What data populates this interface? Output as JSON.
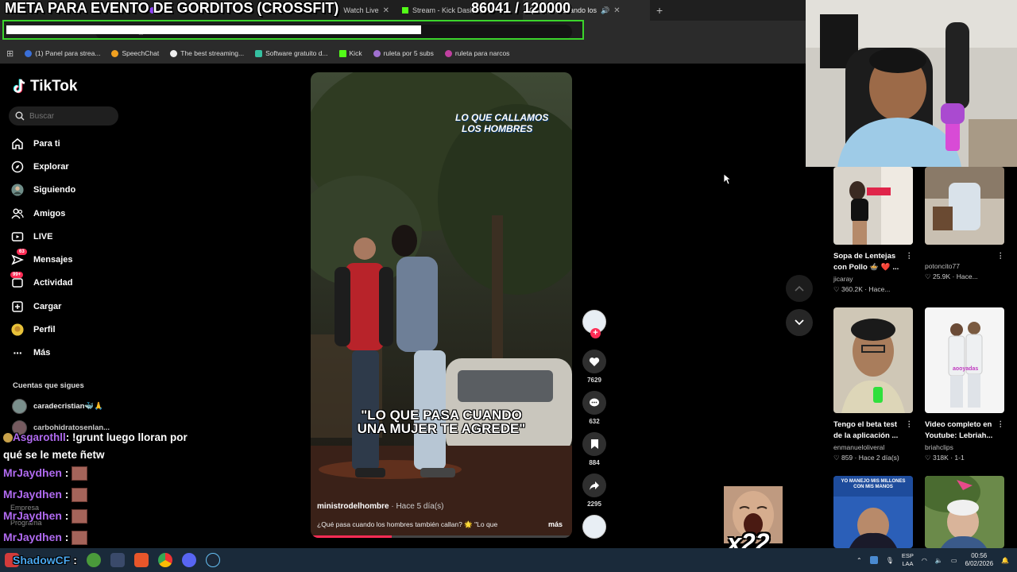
{
  "overlay": {
    "title": "META PARA EVENTO DE GORDITOS (CROSSFIT)",
    "counter": "86041   / 120000",
    "progress": 0.717
  },
  "browser": {
    "tabs": [
      {
        "label": "",
        "icon": "speaker-icon"
      },
      {
        "label": "",
        "icon": "twitch-icon"
      },
      {
        "label": "Watch Live",
        "icon": "kick-icon"
      },
      {
        "label": "Stream - Kick Dashboard",
        "icon": "kick-icon"
      },
      {
        "label": "Qué pasa cuando los",
        "icon": "tiktok-icon",
        "active": true
      }
    ],
    "url": "tiktok.com/@ministrodelhombre/video/7...",
    "bookmarks": [
      {
        "label": "(1) Panel para strea...",
        "color": "#3a6fd8"
      },
      {
        "label": "SpeechChat",
        "color": "#f0a020"
      },
      {
        "label": "The best streaming...",
        "color": "#eeeeee"
      },
      {
        "label": "Software gratuito d...",
        "color": "#35c0a0"
      },
      {
        "label": "Kick",
        "color": "#53fc18"
      },
      {
        "label": "ruleta por 5 subs",
        "color": "#a070d0"
      },
      {
        "label": "ruleta para narcos",
        "color": "#c040a0"
      }
    ]
  },
  "tiktok": {
    "logo": "TikTok",
    "search_placeholder": "Buscar",
    "nav": [
      {
        "label": "Para ti",
        "icon": "home-icon"
      },
      {
        "label": "Explorar",
        "icon": "compass-icon"
      },
      {
        "label": "Siguiendo",
        "icon": "avatar-icon"
      },
      {
        "label": "Amigos",
        "icon": "friends-icon"
      },
      {
        "label": "LIVE",
        "icon": "live-icon"
      },
      {
        "label": "Mensajes",
        "icon": "messages-icon",
        "badge": "63"
      },
      {
        "label": "Actividad",
        "icon": "activity-icon",
        "badge": "99+"
      },
      {
        "label": "Cargar",
        "icon": "upload-icon"
      },
      {
        "label": "Perfil",
        "icon": "profile-icon"
      },
      {
        "label": "Más",
        "icon": "more-icon"
      }
    ],
    "following_title": "Cuentas que sigues",
    "following": [
      {
        "name": "caradecristian🐳🙏"
      },
      {
        "name": "carbohidratosenlan..."
      }
    ],
    "ghost": [
      "Empresa",
      "Programa"
    ]
  },
  "video": {
    "logo_line1": "LO QUE CALLAMOS",
    "logo_line2": "LOS HOMBRES",
    "caption_line1": "\"LO QUE PASA CUANDO",
    "caption_line2": "UNA MUJER TE AGREDE\"",
    "author": "ministrodelhombre",
    "time": " · Hace 5 día(s)",
    "description": "¿Qué pasa cuando los hombres también callan? 🌟 \"Lo que",
    "more": "más",
    "progress": 0.31,
    "likes": "7629",
    "comments": "632",
    "saves": "884",
    "shares": "2295"
  },
  "grid": [
    {
      "title_line1": "Sopa de Lentejas",
      "title_line2": "con Pollo 🍲 ❤️ ...",
      "user": "jicaray",
      "meta": "♡ 360.2K · Hace..."
    },
    {
      "title_line1": "",
      "title_line2": "",
      "user": "potoncito77",
      "meta": "♡ 25.9K · Hace..."
    },
    {
      "title_line1": "Tengo el beta test",
      "title_line2": "de la aplicación ...",
      "user": "enmanueloliveral",
      "meta": "♡ 859 · Hace 2 día(s)"
    },
    {
      "title_line1": "Video completo en",
      "title_line2": "Youtube: Lebriah...",
      "user": "briahclips",
      "meta": "♡ 318K · 1-1"
    }
  ],
  "grid_thumb_texts": {
    "third_row_left": "YO MANEJO MIS MILLONES CON MIS MANOS",
    "second_row_right": "aooyadas"
  },
  "chat": [
    {
      "user": "Asgarothll",
      "message": ": !grunt luego lloran por",
      "cont": "qué se le mete ñetw"
    },
    {
      "user": "MrJaydhen",
      "message": " :"
    },
    {
      "user": "MrJaydhen",
      "message": " :"
    },
    {
      "user": "MrJaydhen",
      "message": " :"
    },
    {
      "user": "MrJaydhen",
      "message": " :"
    },
    {
      "user": "ShadowCF",
      "message": " :"
    }
  ],
  "emote_count": "x22",
  "taskbar": {
    "lang1": "ESP",
    "lang2": "LAA",
    "time": "00:56",
    "date": "6/02/2026"
  }
}
